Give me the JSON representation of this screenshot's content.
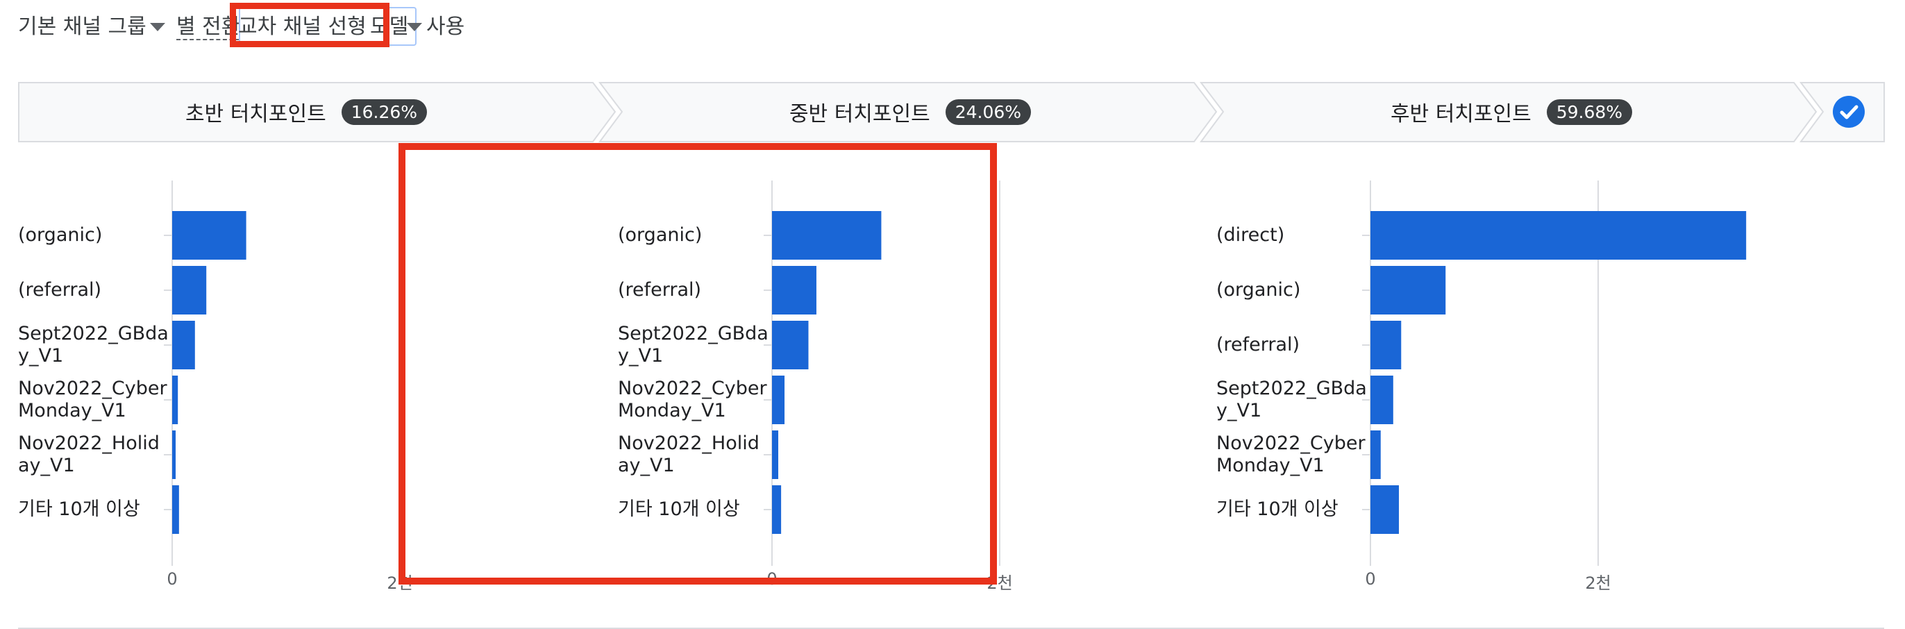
{
  "header": {
    "channel_group": "기본 채널 그룹",
    "by_conversion": "별 전환",
    "model_selected": "교차 채널 선형",
    "model_suffix": "모델",
    "use": "사용"
  },
  "steps": [
    {
      "label": "초반 터치포인트",
      "pct": "16.26%"
    },
    {
      "label": "중반 터치포인트",
      "pct": "24.06%"
    },
    {
      "label": "후반 터치포인트",
      "pct": "59.68%"
    }
  ],
  "colors": {
    "bar": "#1a66d6",
    "highlight": "#e8321b",
    "grid": "#dadce0"
  },
  "icons": {
    "dropdown": "caret-down-icon",
    "done": "check-circle-icon"
  },
  "chart_data": [
    {
      "type": "bar",
      "title": "초반 터치포인트",
      "orientation": "horizontal",
      "categories": [
        "(organic)",
        "(referral)",
        "Sept2022_GBday_V1",
        "Nov2022_CyberMonday_V1",
        "Nov2022_Holiday_V1",
        "기타 10개 이상"
      ],
      "values": [
        650,
        300,
        200,
        50,
        30,
        60
      ],
      "xlim": [
        0,
        2000
      ],
      "xticks": [
        "0",
        "2천"
      ]
    },
    {
      "type": "bar",
      "title": "중반 터치포인트",
      "orientation": "horizontal",
      "categories": [
        "(organic)",
        "(referral)",
        "Sept2022_GBday_V1",
        "Nov2022_CyberMonday_V1",
        "Nov2022_Holiday_V1",
        "기타 10개 이상"
      ],
      "values": [
        960,
        390,
        320,
        110,
        55,
        80
      ],
      "xlim": [
        0,
        2000
      ],
      "xticks": [
        "0",
        "2천"
      ]
    },
    {
      "type": "bar",
      "title": "후반 터치포인트",
      "orientation": "horizontal",
      "categories": [
        "(direct)",
        "(organic)",
        "(referral)",
        "Sept2022_GBday_V1",
        "Nov2022_CyberMonday_V1",
        "기타 10개 이상"
      ],
      "values": [
        3300,
        660,
        270,
        200,
        90,
        250
      ],
      "xlim": [
        0,
        2000
      ],
      "xticks": [
        "0",
        "2천"
      ]
    }
  ]
}
